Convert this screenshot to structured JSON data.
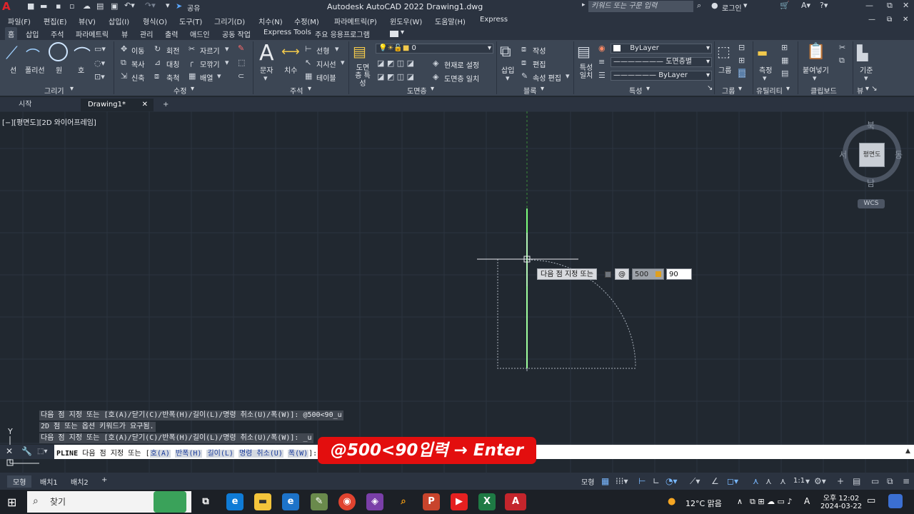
{
  "title_bar": {
    "app_logo": "A",
    "title": "Autodesk AutoCAD 2022    Drawing1.dwg",
    "share_label": "공유",
    "search_placeholder": "키워드 또는 구문 입력",
    "login_label": "로그인"
  },
  "menu": {
    "items": [
      "파일(F)",
      "편집(E)",
      "뷰(V)",
      "삽입(I)",
      "형식(O)",
      "도구(T)",
      "그리기(D)",
      "치수(N)",
      "수정(M)",
      "파라메트릭(P)",
      "윈도우(W)",
      "도움말(H)",
      "Express"
    ]
  },
  "ribbon_tabs": {
    "items": [
      "홈",
      "삽입",
      "주석",
      "파라메트릭",
      "뷰",
      "관리",
      "출력",
      "애드인",
      "공동 작업",
      "Express Tools",
      "주요 응용프로그램"
    ],
    "active": "홈"
  },
  "ribbon": {
    "draw": {
      "line": "선",
      "polyline": "폴리선",
      "circle": "원",
      "arc": "호",
      "title": "그리기"
    },
    "modify": {
      "move": "이동",
      "rotate": "회전",
      "trim": "자르기",
      "copy": "복사",
      "mirror": "대칭",
      "fillet": "모깎기",
      "stretch": "신축",
      "scale": "축척",
      "array": "배열",
      "title": "수정"
    },
    "annotation": {
      "text": "문자",
      "dimension": "치수",
      "linear": "선형",
      "leader": "지시선",
      "table": "테이블",
      "title": "주석"
    },
    "layers": {
      "properties": "도면층 특성",
      "current_layer": "0",
      "set_current": "현재로 설정",
      "match": "도면층 일치",
      "title": "도면층"
    },
    "block": {
      "insert": "삽입",
      "create": "작성",
      "edit": "편집",
      "edit_attr": "속성 편집",
      "title": "블록"
    },
    "properties": {
      "match": "특성 일치",
      "color": "ByLayer",
      "linetype": "도면층별",
      "lineweight": "ByLayer",
      "title": "특성"
    },
    "groups": {
      "group": "그룹",
      "title": "그룹"
    },
    "utilities": {
      "measure": "측정",
      "title": "유틸리티"
    },
    "clipboard": {
      "paste": "붙여넣기",
      "title": "클립보드"
    },
    "view": {
      "base": "기준",
      "title": "뷰"
    }
  },
  "file_tabs": {
    "start": "시작",
    "drawing": "Drawing1*"
  },
  "viewport": {
    "label": "[−][평면도][2D 와이어프레임]"
  },
  "viewcube": {
    "north": "북",
    "south": "남",
    "east": "동",
    "west": "서",
    "face": "평면도",
    "wcs": "WCS"
  },
  "dynamic_input": {
    "prompt": "다음 점 지정 또는",
    "at": "@",
    "distance": "500",
    "angle": "90"
  },
  "command_history": [
    "다음 점 지정 또는 [호(A)/닫기(C)/반폭(H)/길이(L)/명령 취소(U)/폭(W)]: @500<90_u",
    "2D 점 또는 옵션 키워드가 요구됨.",
    "다음 점 지정 또는 [호(A)/닫기(C)/반폭(H)/길이(L)/명령 취소(U)/폭(W)]: _u"
  ],
  "command_line": {
    "command": "PLINE",
    "prompt": "다음 점 지정 또는 [",
    "options": [
      "호(A)",
      "반폭(H)",
      "길이(L)",
      "명령 취소(U)",
      "폭(W)"
    ],
    "suffix": "]:"
  },
  "overlay_banner": "@500<90입력 → Enter",
  "layout_tabs": [
    "모형",
    "배치1",
    "배치2"
  ],
  "status": {
    "model": "모형",
    "scale": "1:1"
  },
  "taskbar": {
    "search": "찾기",
    "weather": "12°C  맑음",
    "time": "오후 12:02",
    "date": "2024-03-22",
    "ime": "A"
  },
  "colors": {
    "canvas": "#212830",
    "ribbon": "#3c4654",
    "banner": "#e30e0e",
    "accent_y_axis": "#4caf50"
  }
}
